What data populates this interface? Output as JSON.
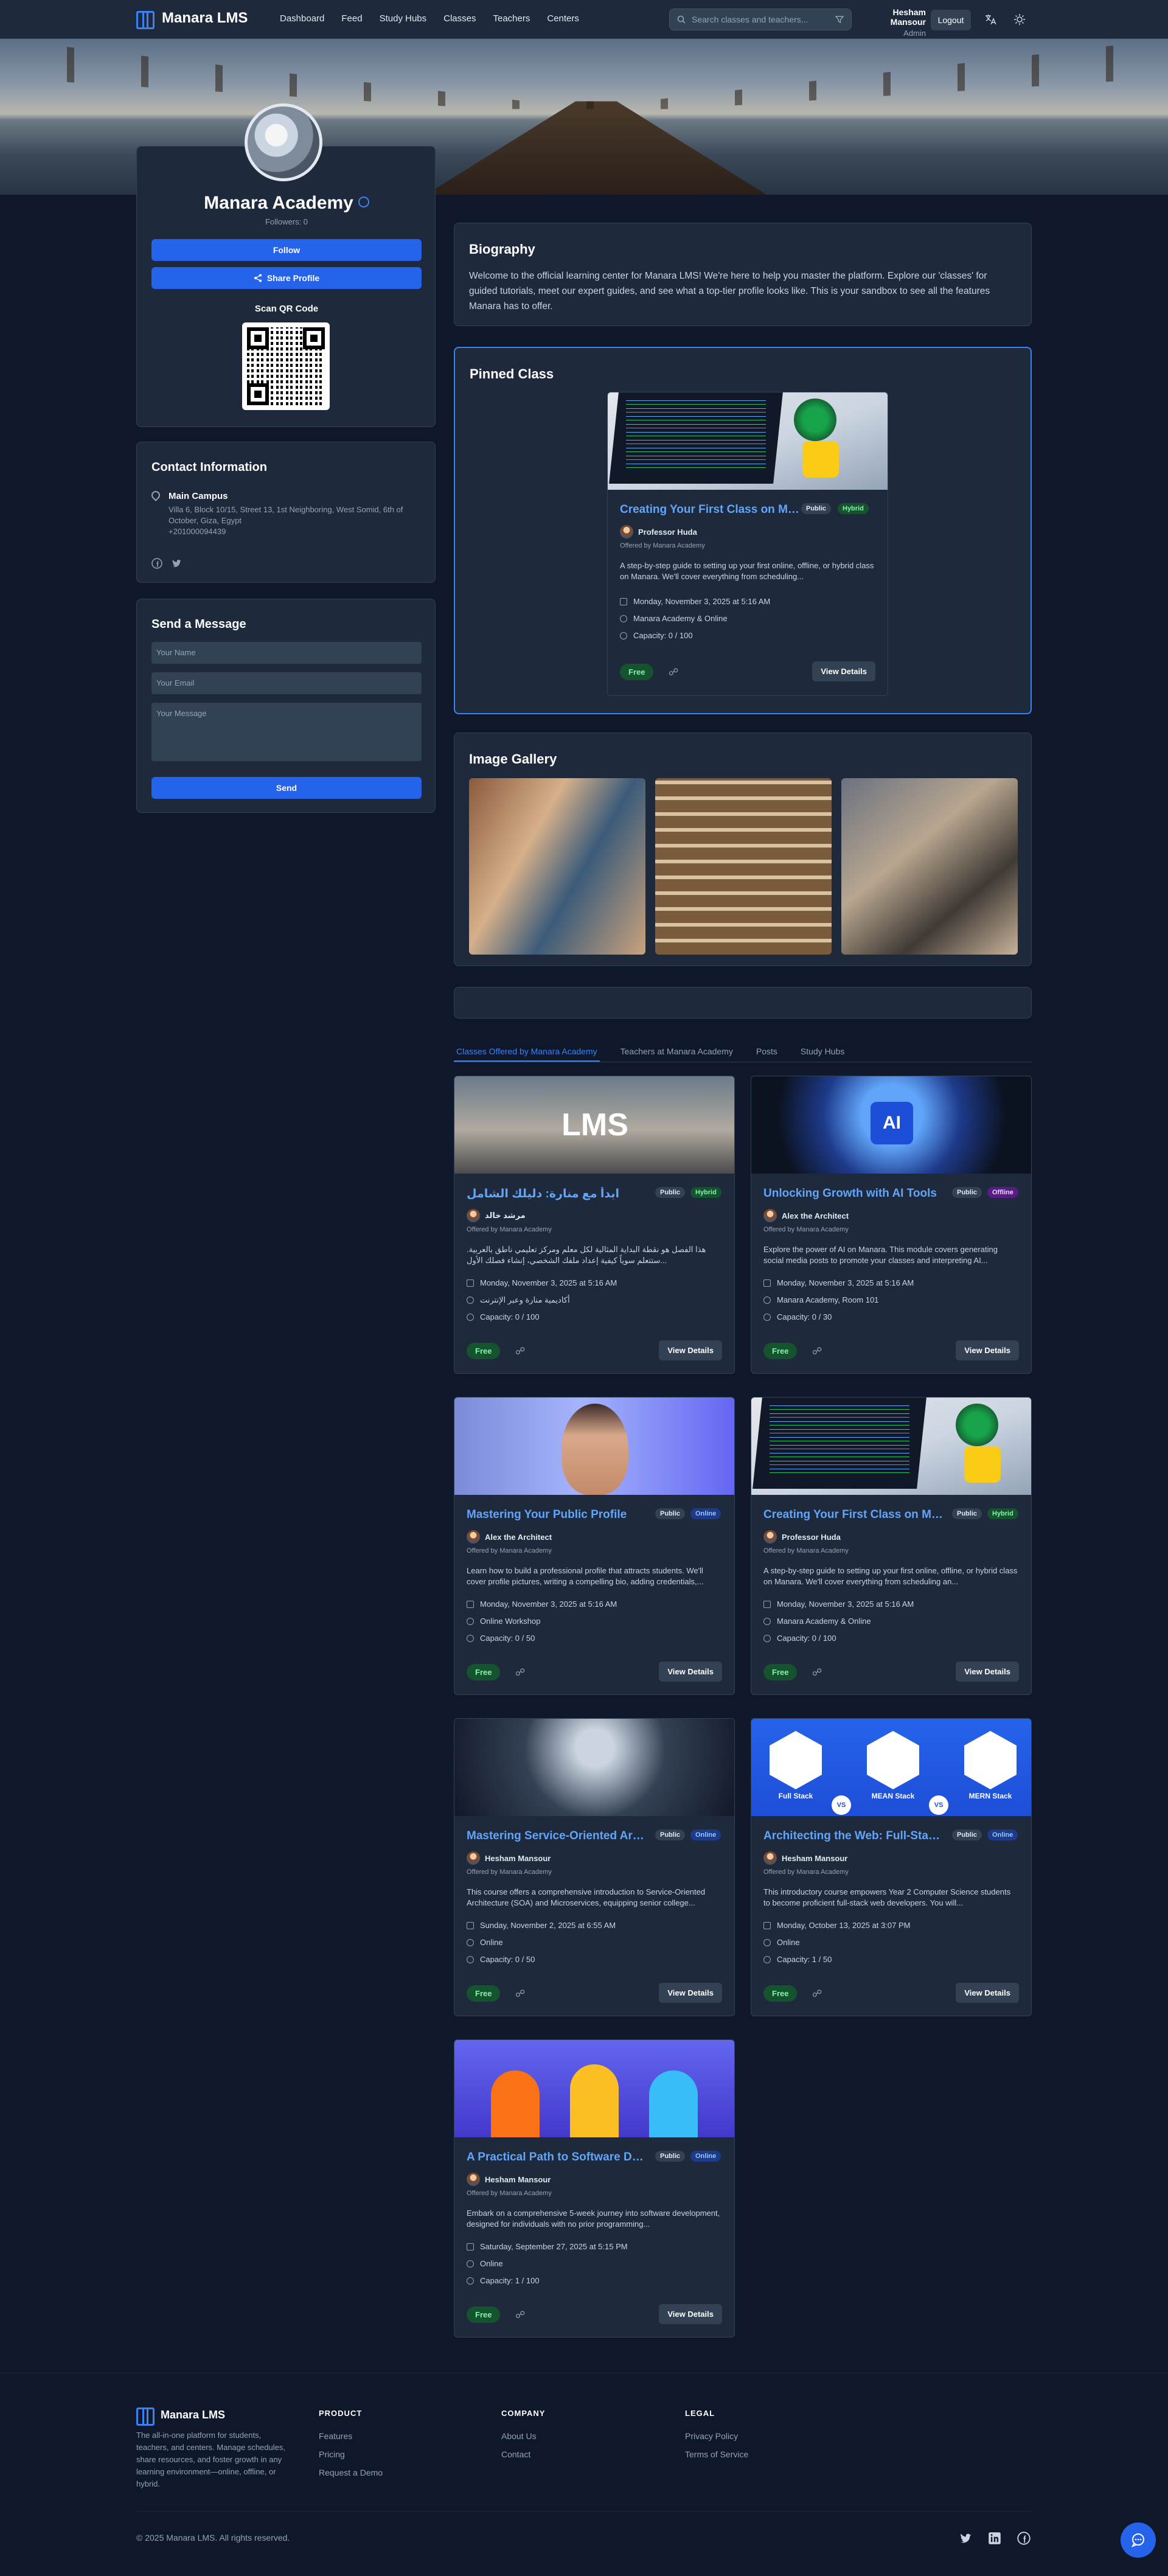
{
  "nav": {
    "brand": "Manara LMS",
    "links": [
      "Dashboard",
      "Feed",
      "Study Hubs",
      "Classes",
      "Teachers",
      "Centers"
    ],
    "search_placeholder": "Search classes and teachers...",
    "user_name": "Hesham Mansour",
    "user_role": "Admin",
    "logout": "Logout"
  },
  "profile": {
    "name": "Manara Academy",
    "followers": "Followers: 0",
    "follow": "Follow",
    "share": "Share Profile",
    "qr_title": "Scan QR Code"
  },
  "contact": {
    "title": "Contact Information",
    "location_title": "Main Campus",
    "address": "Villa 6, Block 10/15, Street 13, 1st Neighboring, West Somid, 6th of October, Giza, Egypt",
    "phone": "+201000094439"
  },
  "message": {
    "title": "Send a Message",
    "name_placeholder": "Your Name",
    "email_placeholder": "Your Email",
    "message_placeholder": "Your Message",
    "send": "Send"
  },
  "bio": {
    "title": "Biography",
    "text": "Welcome to the official learning center for Manara LMS! We're here to help you master the platform. Explore our 'classes' for guided tutorials, meet our expert guides, and see what a top-tier profile looks like. This is your sandbox to see all the features Manara has to offer."
  },
  "pinned": {
    "title": "Pinned Class",
    "card": {
      "title": "Creating Your First Class on Manara",
      "badges": [
        "Public",
        "Hybrid"
      ],
      "teacher": "Professor Huda",
      "offered": "Offered by Manara Academy",
      "desc": "A step-by-step guide to setting up your first online, offline, or hybrid class on Manara. We'll cover everything from scheduling...",
      "date": "Monday, November 3, 2025 at 5:16 AM",
      "location": "Manara Academy & Online",
      "capacity": "Capacity: 0 / 100",
      "price": "Free",
      "details": "View Details"
    }
  },
  "gallery": {
    "title": "Image Gallery"
  },
  "tabs": [
    "Classes Offered by Manara Academy",
    "Teachers at Manara Academy",
    "Posts",
    "Study Hubs"
  ],
  "classes": [
    {
      "title": "ابدأ مع منارة: دليلك الشامل",
      "badges": [
        "Public",
        "Hybrid"
      ],
      "teacher": "مرشد خالد",
      "offered": "Offered by Manara Academy",
      "desc": "هذا الفصل هو نقطة البداية المثالية لكل معلم ومركز تعليمي ناطق بالعربية. ستتعلم سوياً كيفية إعداد ملفك الشخصي، إنشاء فصلك الأول...",
      "date": "Monday, November 3, 2025 at 5:16 AM",
      "location": "أكاديمية منارة وعبر الإنترنت",
      "capacity": "Capacity: 0 / 100",
      "price": "Free",
      "details": "View Details"
    },
    {
      "title": "Unlocking Growth with AI Tools",
      "badges": [
        "Public",
        "Offline"
      ],
      "teacher": "Alex the Architect",
      "offered": "Offered by Manara Academy",
      "desc": "Explore the power of AI on Manara. This module covers generating social media posts to promote your classes and interpreting AI...",
      "date": "Monday, November 3, 2025 at 5:16 AM",
      "location": "Manara Academy, Room 101",
      "capacity": "Capacity: 0 / 30",
      "price": "Free",
      "details": "View Details"
    },
    {
      "title": "Mastering Your Public Profile",
      "badges": [
        "Public",
        "Online"
      ],
      "teacher": "Alex the Architect",
      "offered": "Offered by Manara Academy",
      "desc": "Learn how to build a professional profile that attracts students. We'll cover profile pictures, writing a compelling bio, adding credentials,...",
      "date": "Monday, November 3, 2025 at 5:16 AM",
      "location": "Online Workshop",
      "capacity": "Capacity: 0 / 50",
      "price": "Free",
      "details": "View Details"
    },
    {
      "title": "Creating Your First Class on Manara",
      "badges": [
        "Public",
        "Hybrid"
      ],
      "teacher": "Professor Huda",
      "offered": "Offered by Manara Academy",
      "desc": "A step-by-step guide to setting up your first online, offline, or hybrid class on Manara. We'll cover everything from scheduling an...",
      "date": "Monday, November 3, 2025 at 5:16 AM",
      "location": "Manara Academy & Online",
      "capacity": "Capacity: 0 / 100",
      "price": "Free",
      "details": "View Details"
    },
    {
      "title": "Mastering Service-Oriented Architecture",
      "badges": [
        "Public",
        "Online"
      ],
      "teacher": "Hesham Mansour",
      "offered": "Offered by Manara Academy",
      "desc": "This course offers a comprehensive introduction to Service-Oriented Architecture (SOA) and Microservices, equipping senior college...",
      "date": "Sunday, November 2, 2025 at 6:55 AM",
      "location": "Online",
      "capacity": "Capacity: 0 / 50",
      "price": "Free",
      "details": "View Details"
    },
    {
      "title": "Architecting the Web: Full-Stack Development",
      "badges": [
        "Public",
        "Online"
      ],
      "teacher": "Hesham Mansour",
      "offered": "Offered by Manara Academy",
      "desc": "This introductory course empowers Year 2 Computer Science students to become proficient full-stack web developers. You will...",
      "date": "Monday, October 13, 2025 at 3:07 PM",
      "location": "Online",
      "capacity": "Capacity: 1 / 50",
      "price": "Free",
      "details": "View Details"
    },
    {
      "title": "A Practical Path to Software Development",
      "badges": [
        "Public",
        "Online"
      ],
      "teacher": "Hesham Mansour",
      "offered": "Offered by Manara Academy",
      "desc": "Embark on a comprehensive 5-week journey into software development, designed for individuals with no prior programming...",
      "date": "Saturday, September 27, 2025 at 5:15 PM",
      "location": "Online",
      "capacity": "Capacity: 1 / 100",
      "price": "Free",
      "details": "View Details"
    }
  ],
  "card_images": {
    "lms_text": "LMS",
    "ai_text": "AI",
    "fullstack": [
      "Full Stack",
      "MEAN Stack",
      "MERN Stack"
    ],
    "vs": "VS"
  },
  "footer": {
    "brand": "Manara LMS",
    "tagline": "The all-in-one platform for students, teachers, and centers. Manage schedules, share resources, and foster growth in any learning environment—online, offline, or hybrid.",
    "product_title": "PRODUCT",
    "product": [
      "Features",
      "Pricing",
      "Request a Demo"
    ],
    "company_title": "COMPANY",
    "company": [
      "About Us",
      "Contact"
    ],
    "legal_title": "LEGAL",
    "legal": [
      "Privacy Policy",
      "Terms of Service"
    ],
    "copyright": "© 2025 Manara LMS. All rights reserved."
  },
  "colors": {
    "accent": "#3b82f6",
    "bg": "#0f172a",
    "card": "#1e293b",
    "free": "#86efac"
  },
  "icons": [
    "book-icon",
    "search-icon",
    "filter-icon",
    "translate-icon",
    "sun-icon",
    "share-icon",
    "calendar-icon",
    "location-icon",
    "users-icon",
    "twitter-icon",
    "linkedin-icon",
    "facebook-icon",
    "chat-icon"
  ]
}
